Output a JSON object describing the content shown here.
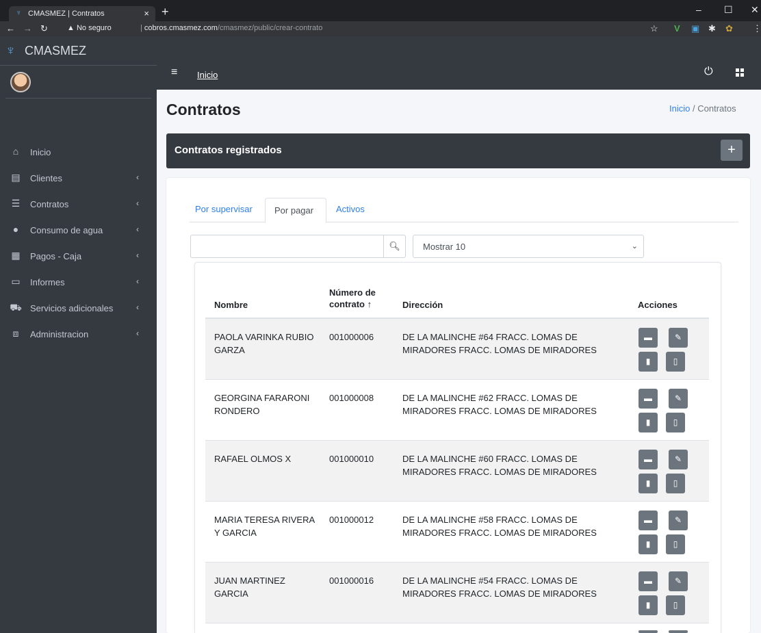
{
  "browser": {
    "tab_title": "CMASMEZ | Contratos",
    "tab_close": "×",
    "new_tab": "+",
    "security": "No seguro",
    "url_host": "cobros.cmasmez.com",
    "url_path": "/cmasmez/public/crear-contrato"
  },
  "sidebar": {
    "brand": "CMASMEZ",
    "items": [
      {
        "label": "Inicio",
        "icon": "home-icon",
        "submenu": false
      },
      {
        "label": "Clientes",
        "icon": "address-book-icon",
        "submenu": true
      },
      {
        "label": "Contratos",
        "icon": "list-icon",
        "submenu": true
      },
      {
        "label": "Consumo de agua",
        "icon": "water-drop-icon",
        "submenu": true
      },
      {
        "label": "Pagos - Caja",
        "icon": "cash-register-icon",
        "submenu": true
      },
      {
        "label": "Informes",
        "icon": "file-icon",
        "submenu": true
      },
      {
        "label": "Servicios adicionales",
        "icon": "cart-icon",
        "submenu": true
      },
      {
        "label": "Administracion",
        "icon": "toolbox-icon",
        "submenu": true
      }
    ]
  },
  "topnav": {
    "link": "Inicio"
  },
  "page": {
    "title": "Contratos",
    "breadcrumb": {
      "home": "Inicio",
      "sep": "/",
      "current": "Contratos"
    }
  },
  "header_card": {
    "title": "Contratos registrados",
    "add_label": "+"
  },
  "tabs": [
    {
      "label": "Por supervisar",
      "active": false
    },
    {
      "label": "Por pagar",
      "active": true
    },
    {
      "label": "Activos",
      "active": false
    }
  ],
  "search": {
    "value": "",
    "placeholder": ""
  },
  "page_size": {
    "selected": "Mostrar 10"
  },
  "table": {
    "headers": {
      "nombre": "Nombre",
      "numero_l1": "Número de",
      "numero_l2": "contrato ↑",
      "direccion": "Dirección",
      "acciones": "Acciones"
    },
    "rows": [
      {
        "nombre": "PAOLA VARINKA RUBIO GARZA",
        "numero": "001000006",
        "direccion": "DE LA MALINCHE #64 FRACC. LOMAS DE MIRADORES FRACC. LOMAS DE MIRADORES"
      },
      {
        "nombre": "GEORGINA FARARONI RONDERO",
        "numero": "001000008",
        "direccion": "DE LA MALINCHE #62 FRACC. LOMAS DE MIRADORES FRACC. LOMAS DE MIRADORES"
      },
      {
        "nombre": "RAFAEL OLMOS X",
        "numero": "001000010",
        "direccion": "DE LA MALINCHE #60 FRACC. LOMAS DE MIRADORES FRACC. LOMAS DE MIRADORES"
      },
      {
        "nombre": "MARIA TERESA RIVERA Y GARCIA",
        "numero": "001000012",
        "direccion": "DE LA MALINCHE #58 FRACC. LOMAS DE MIRADORES FRACC. LOMAS DE MIRADORES"
      },
      {
        "nombre": "JUAN MARTINEZ GARCIA",
        "numero": "001000016",
        "direccion": "DE LA MALINCHE #54 FRACC. LOMAS DE MIRADORES FRACC. LOMAS DE MIRADORES"
      }
    ]
  },
  "colors": {
    "sidebar_bg": "#343a40",
    "link": "#2f80ed",
    "action_btn": "#6c757d",
    "row_stripe": "#f2f2f2"
  }
}
